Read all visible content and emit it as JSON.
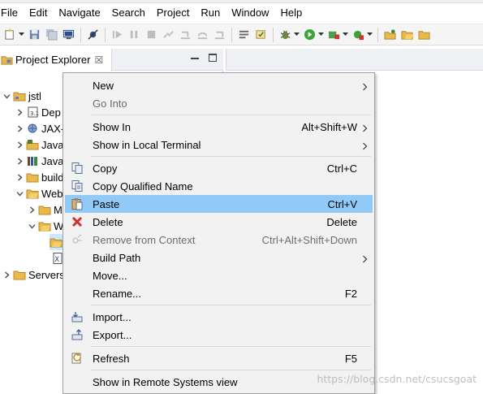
{
  "menubar": [
    "File",
    "Edit",
    "Navigate",
    "Search",
    "Project",
    "Run",
    "Window",
    "Help"
  ],
  "explorer": {
    "title": "Project Explorer",
    "close_glyph": "☒"
  },
  "tree": [
    {
      "label": "jstl",
      "expanded": true
    },
    {
      "label": "Dep"
    },
    {
      "label": "JAX-"
    },
    {
      "label": "Java"
    },
    {
      "label": "Java"
    },
    {
      "label": "build"
    },
    {
      "label": "Web",
      "expanded": true
    },
    {
      "label": "M"
    },
    {
      "label": "W",
      "expanded": true
    },
    {
      "label": "",
      "selected": true
    },
    {
      "label": ""
    },
    {
      "label": "Servers"
    }
  ],
  "context_menu": {
    "new": {
      "label": "New"
    },
    "go_into": {
      "label": "Go Into"
    },
    "show_in": {
      "label": "Show In",
      "shortcut": "Alt+Shift+W"
    },
    "show_in_terminal": {
      "label": "Show in Local Terminal"
    },
    "copy": {
      "label": "Copy",
      "shortcut": "Ctrl+C"
    },
    "copy_qualified": {
      "label": "Copy Qualified Name"
    },
    "paste": {
      "label": "Paste",
      "shortcut": "Ctrl+V"
    },
    "delete": {
      "label": "Delete",
      "shortcut": "Delete"
    },
    "remove_context": {
      "label": "Remove from Context",
      "shortcut": "Ctrl+Alt+Shift+Down"
    },
    "build_path": {
      "label": "Build Path"
    },
    "move": {
      "label": "Move..."
    },
    "rename": {
      "label": "Rename...",
      "shortcut": "F2"
    },
    "import": {
      "label": "Import..."
    },
    "export": {
      "label": "Export..."
    },
    "refresh": {
      "label": "Refresh",
      "shortcut": "F5"
    },
    "show_remote": {
      "label": "Show in Remote Systems view"
    }
  },
  "watermark": "https://blog.csdn.net/csucsgoat",
  "colors": {
    "highlight": "#91c9f7",
    "menu_bg": "#f2f2f2",
    "disabled_text": "#6d6d6d"
  }
}
